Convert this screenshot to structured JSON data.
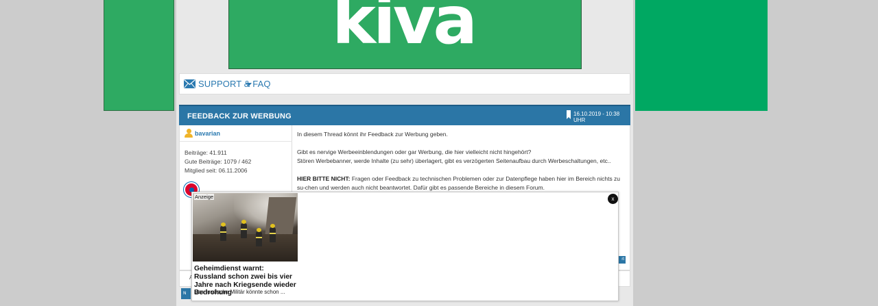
{
  "ads": {
    "banner_brand": "kiva",
    "brand_color": "#2eaa62",
    "right_side_color": "#00a862"
  },
  "nav": {
    "support_label": "SUPPORT & FAQ",
    "mail_icon": "mail-icon",
    "caret_icon": "caret-down-icon"
  },
  "thread": {
    "title": "FEEDBACK ZUR WERBUNG",
    "date": "16.10.2019 - 10:38 UHR",
    "header_color": "#2b76a6"
  },
  "post": {
    "author": "bavarian",
    "stats": [
      "Beiträge: 41.911",
      "Gute Beiträge: 1079 / 462",
      "Mitglied seit: 06.11.2006"
    ],
    "paragraph1": "In diesem Thread könnt ihr Feedback zur Werbung geben.",
    "paragraph2_line1": "Gibt es nervige Werbeeinblendungen oder gar Werbung, die hier vielleicht nicht hingehört?",
    "paragraph2_line2": "Stören Werbebanner, werde Inhalte (zu sehr) überlagert, gibt es verzögerten Seitenaufbau durch Werbeschaltungen, etc..",
    "paragraph3_bold": "HIER BITTE NICHT:",
    "paragraph3_text": " Fragen oder Feedback zu technischen Problemen oder zur Datenpflege haben hier im Bereich nichts zu su-chen und werden auch nicht beantwortet. Dafür gibt es passende Bereiche in diesem Forum.",
    "reply_fragment": "rt",
    "bottom_fragment": "N",
    "below_fragment": "A"
  },
  "overlay": {
    "label": "Anzeige",
    "headline": "Geheimdienst warnt: Russland schon zwei bis vier Jahre nach Kriegsende wieder Bedrohung",
    "description": "Das russische Militär könnte schon ...",
    "close_label": "x"
  }
}
